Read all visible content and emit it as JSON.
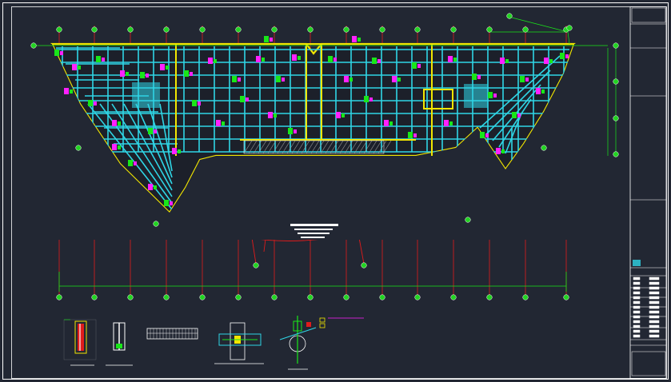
{
  "viewer": {
    "background_color": "#222733",
    "frame_color": "#ffffff",
    "layer_colors": {
      "axis_lines": "#e01b1b",
      "axis_bubbles": "#22d322",
      "beams": "#2fd6e6",
      "walls": "#f2e600",
      "rebar_tags": "#ff21ff",
      "annotations": "#19e619",
      "dimensions": "#19e619"
    }
  },
  "title_block": {
    "company_logo": "company-logo-icon",
    "rows": [
      "",
      "",
      "",
      "",
      "",
      "",
      "",
      "",
      ""
    ]
  },
  "sheet_note": {
    "lines": [
      "",
      "",
      "",
      ""
    ]
  },
  "detail_views": [
    {
      "name": "column-section-detail"
    },
    {
      "name": "steel-h-section-detail"
    },
    {
      "name": "beam-elevation-detail"
    },
    {
      "name": "beam-column-joint-detail"
    },
    {
      "name": "circular-column-joint-detail"
    }
  ]
}
